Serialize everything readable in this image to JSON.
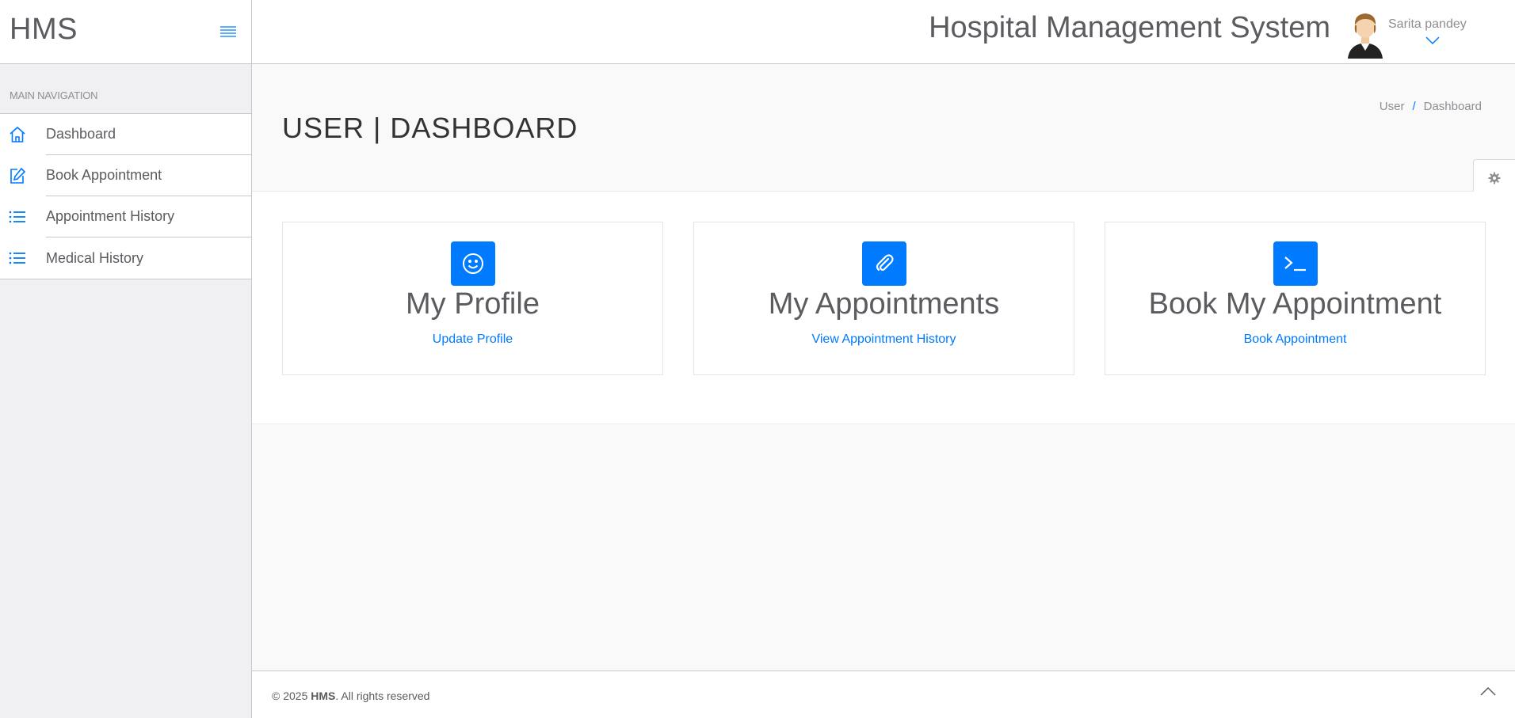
{
  "sidebar": {
    "brand": "HMS",
    "nav_title": "MAIN NAVIGATION",
    "items": [
      {
        "label": "Dashboard",
        "icon": "home-icon"
      },
      {
        "label": "Book Appointment",
        "icon": "edit-icon"
      },
      {
        "label": "Appointment History",
        "icon": "list-icon"
      },
      {
        "label": "Medical History",
        "icon": "list-icon"
      }
    ]
  },
  "header": {
    "title": "Hospital Management System",
    "user_name": "Sarita pandey"
  },
  "page": {
    "title": "USER | DASHBOARD",
    "breadcrumb": {
      "root": "User",
      "sep": "/",
      "current": "Dashboard"
    }
  },
  "cards": [
    {
      "title": "My Profile",
      "link": "Update Profile",
      "icon": "smile-icon"
    },
    {
      "title": "My Appointments",
      "link": "View Appointment History",
      "icon": "paperclip-icon"
    },
    {
      "title": "Book My Appointment",
      "link": "Book Appointment",
      "icon": "terminal-icon"
    }
  ],
  "footer": {
    "copyright_prefix": "© 2025 ",
    "brand": "HMS",
    "suffix": ". All rights reserved"
  },
  "colors": {
    "accent": "#007aff",
    "text": "#5b5b60",
    "sidebar_bg": "#f0f0f3"
  }
}
